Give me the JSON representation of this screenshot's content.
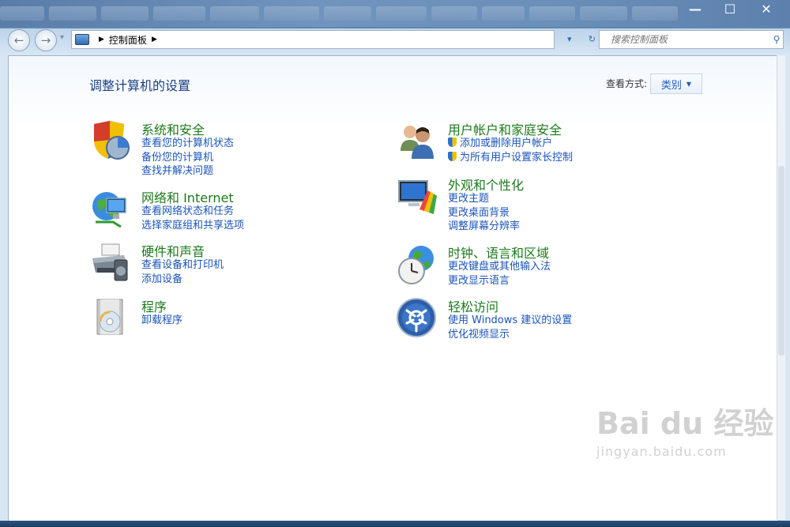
{
  "window": {
    "minimize": "—",
    "maximize": "☐",
    "close": "✕"
  },
  "nav": {
    "back": "←",
    "forward": "→",
    "dropdown": "▾",
    "breadcrumb": [
      "控制面板"
    ],
    "refresh": "↻",
    "search_placeholder": "搜索控制面板",
    "search_icon": "search-icon"
  },
  "main": {
    "title": "调整计算机的设置",
    "view_by_label": "查看方式:",
    "view_by_value": "类别",
    "categories_left": [
      {
        "title": "系统和安全",
        "icon": "system-security-icon",
        "links": [
          "查看您的计算机状态",
          "备份您的计算机",
          "查找并解决问题"
        ]
      },
      {
        "title": "网络和 Internet",
        "icon": "network-internet-icon",
        "links": [
          "查看网络状态和任务",
          "选择家庭组和共享选项"
        ]
      },
      {
        "title": "硬件和声音",
        "icon": "hardware-sound-icon",
        "links": [
          "查看设备和打印机",
          "添加设备"
        ]
      },
      {
        "title": "程序",
        "icon": "programs-icon",
        "links": [
          "卸载程序"
        ]
      }
    ],
    "categories_right": [
      {
        "title": "用户帐户和家庭安全",
        "icon": "user-accounts-icon",
        "links": [
          "添加或删除用户帐户",
          "为所有用户设置家长控制"
        ]
      },
      {
        "title": "外观和个性化",
        "icon": "appearance-icon",
        "links": [
          "更改主题",
          "更改桌面背景",
          "调整屏幕分辨率"
        ]
      },
      {
        "title": "时钟、语言和区域",
        "icon": "clock-language-icon",
        "links": [
          "更改键盘或其他输入法",
          "更改显示语言"
        ]
      },
      {
        "title": "轻松访问",
        "icon": "ease-of-access-icon",
        "links": [
          "使用 Windows 建议的设置",
          "优化视频显示"
        ]
      }
    ]
  },
  "watermark": {
    "brand": "Bai du 经验",
    "url": "jingyan.baidu.com"
  }
}
